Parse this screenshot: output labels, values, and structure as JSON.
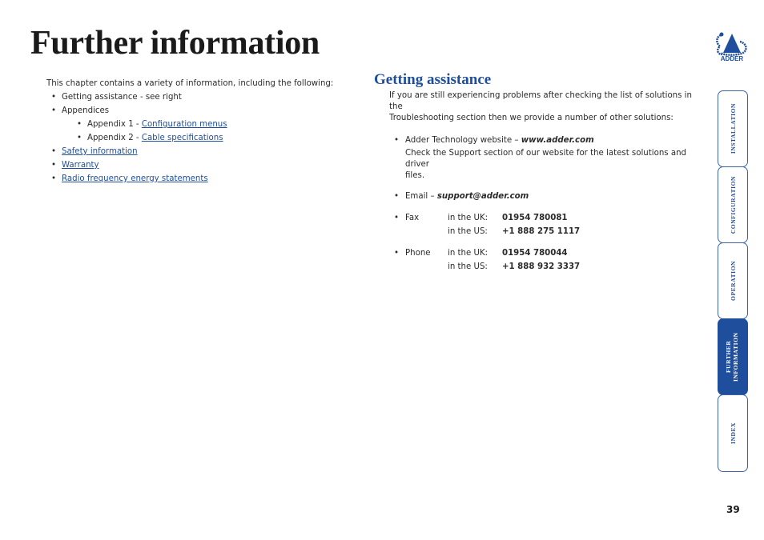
{
  "page": {
    "title": "Further information",
    "number": "39"
  },
  "brand": {
    "logo_text": "ADDER",
    "accent": "#1f4e9c"
  },
  "intro": {
    "lead": "This chapter contains a variety of information, including the following:",
    "items": [
      {
        "text": "Getting assistance - see right"
      },
      {
        "text": "Appendices"
      },
      {
        "prefix": "Appendix 1 - ",
        "link": "Configuration menus"
      },
      {
        "prefix": "Appendix 2 - ",
        "link": "Cable specifications"
      },
      {
        "link": "Safety information"
      },
      {
        "link": "Warranty"
      },
      {
        "link": "Radio frequency energy statements"
      }
    ]
  },
  "assistance": {
    "title": "Getting assistance",
    "line1": "If you are still experiencing problems after checking the list of solutions in the",
    "line2": "Troubleshooting section then we provide a number of other solutions:",
    "website": {
      "label": "Adder Technology website – ",
      "url": "www.adder.com",
      "desc1": "Check the Support section of our website for the latest solutions and driver",
      "desc2": "files."
    },
    "email": {
      "label": "Email – ",
      "address": "support@adder.com"
    },
    "fax": {
      "label": "Fax",
      "uk_label": "in the UK:",
      "uk": "01954 780081",
      "us_label": "in the US:",
      "us": "+1 888 275 1117"
    },
    "phone": {
      "label": "Phone",
      "uk_label": "in the UK:",
      "uk": "01954 780044",
      "us_label": "in the US:",
      "us": "+1 888 932 3337"
    }
  },
  "tabs": [
    {
      "label": "INSTALLATION",
      "active": false
    },
    {
      "label": "CONFIGURATION",
      "active": false
    },
    {
      "label": "OPERATION",
      "active": false
    },
    {
      "label": "FURTHER INFORMATION",
      "active": true
    },
    {
      "label": "INDEX",
      "active": false
    }
  ]
}
